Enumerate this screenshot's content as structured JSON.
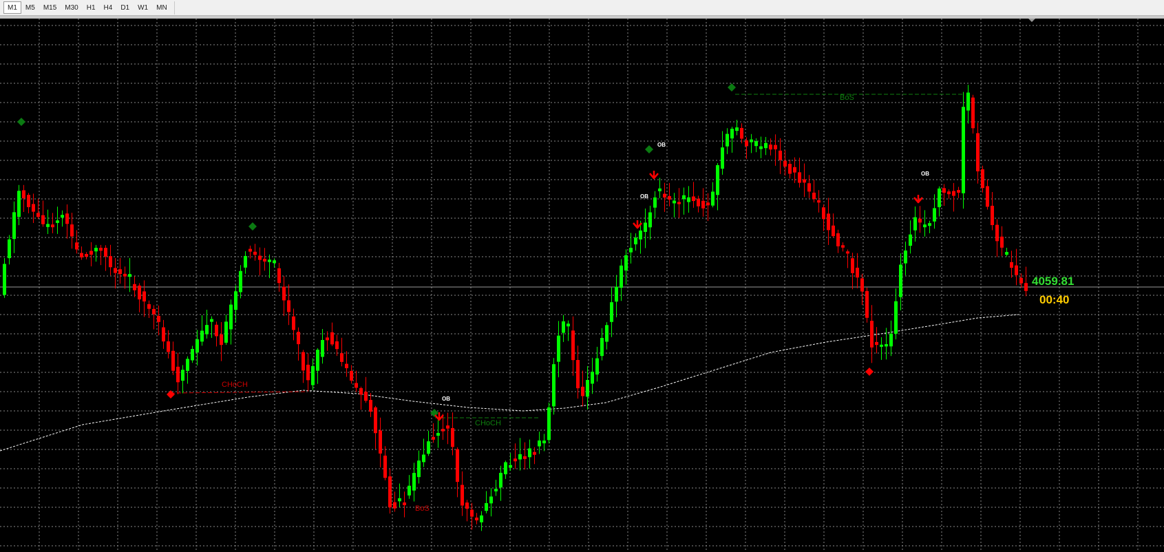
{
  "toolbar": {
    "timeframes": [
      {
        "label": "M1",
        "active": true
      },
      {
        "label": "M5",
        "active": false
      },
      {
        "label": "M15",
        "active": false
      },
      {
        "label": "M30",
        "active": false
      },
      {
        "label": "H1",
        "active": false
      },
      {
        "label": "H4",
        "active": false
      },
      {
        "label": "D1",
        "active": false
      },
      {
        "label": "W1",
        "active": false
      },
      {
        "label": "MN",
        "active": false
      }
    ]
  },
  "chart": {
    "price_label": "4059.81",
    "countdown_label": "00:40",
    "annotations": {
      "choch_left": "CHoCH",
      "choch_mid": "CHoCH",
      "bos_top": "BoS",
      "bos_bottom": "BoS",
      "ob_1": "OB",
      "ob_2": "OB",
      "ob_3": "OB",
      "ob_4": "OB"
    },
    "colors": {
      "background": "#000000",
      "grid": "#8a8a8a",
      "bull": "#00ff00",
      "bear": "#ff0000",
      "moving_average": "#ffffff",
      "swing_high": "#0b7a12",
      "swing_low": "#ff0000",
      "price_text": "#33dd33",
      "countdown_text": "#ffcc00",
      "choch_bear": "#cc0000",
      "choch_bull": "#0f7f0f"
    }
  }
}
